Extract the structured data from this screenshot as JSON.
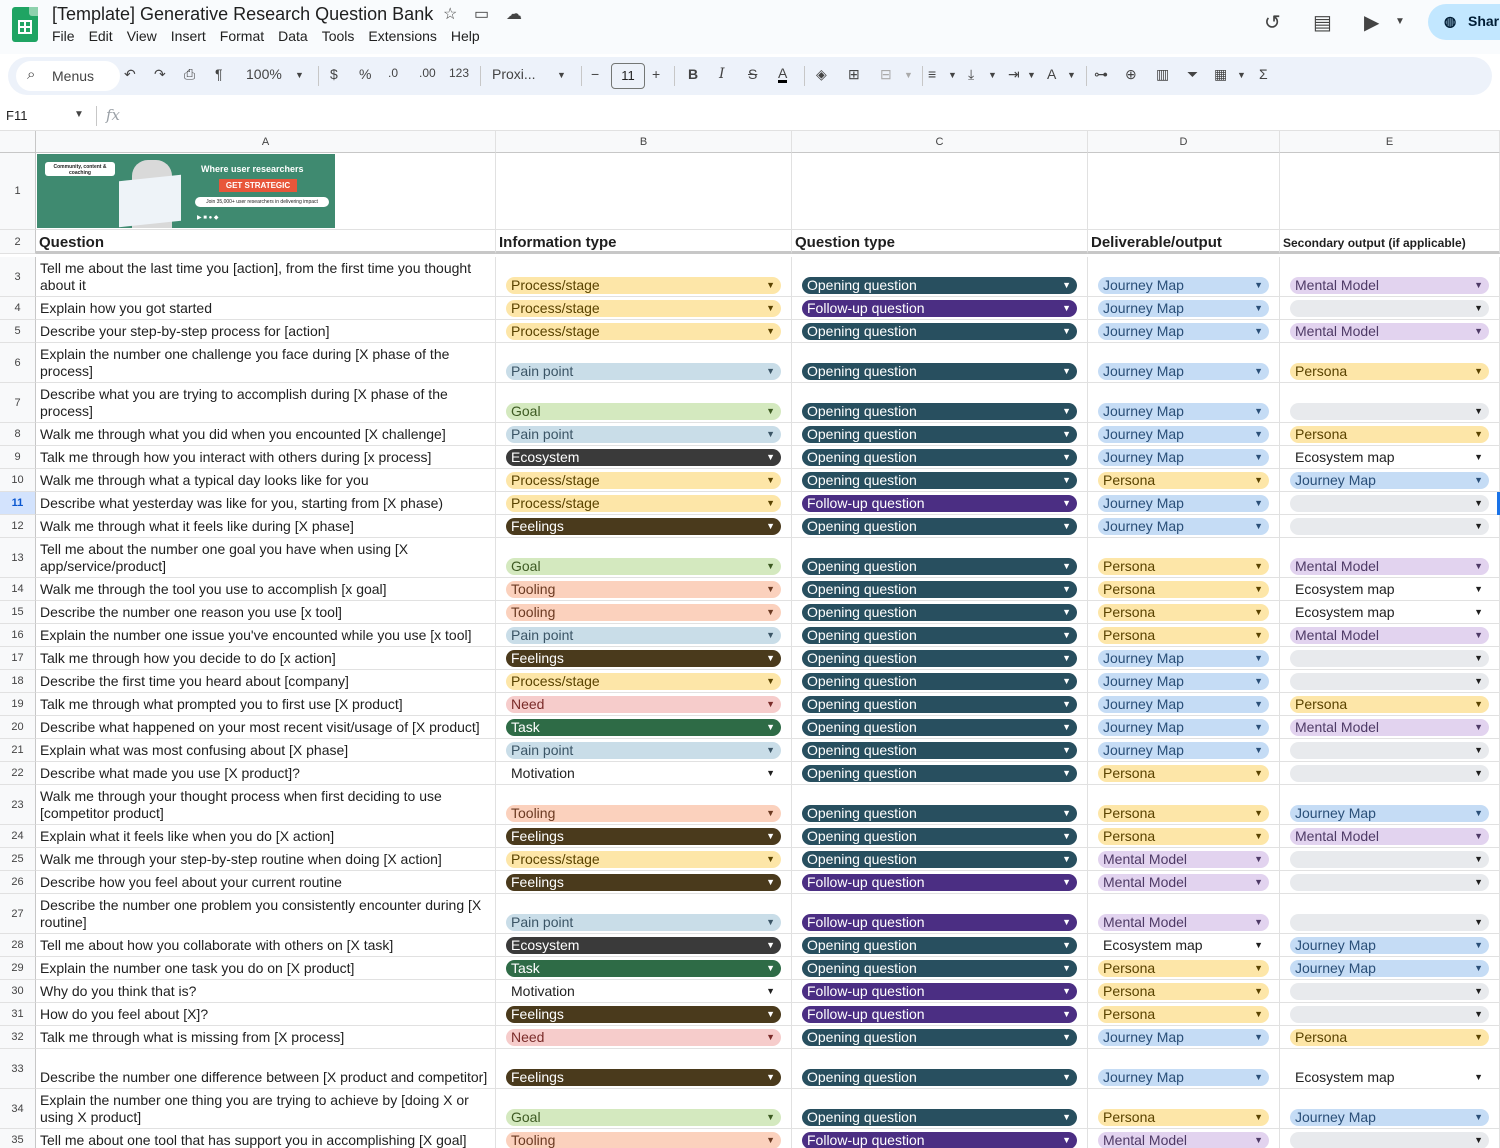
{
  "app": {
    "doc_title": "[Template] Generative Research Question Bank",
    "menu": [
      "File",
      "Edit",
      "View",
      "Insert",
      "Format",
      "Data",
      "Tools",
      "Extensions",
      "Help"
    ],
    "share_label": "Shar"
  },
  "toolbar": {
    "menus_label": "Menus",
    "zoom": "100%",
    "currency": "$",
    "percent": "%",
    "dec_decrease": ".0",
    "dec_increase": ".00",
    "number_format": "123",
    "font": "Proxi...",
    "font_size": "11"
  },
  "formula_bar": {
    "cell_ref": "F11",
    "fx_label": "fx"
  },
  "columns": [
    "A",
    "B",
    "C",
    "D",
    "E"
  ],
  "banner": {
    "badge": "Community, content & coaching",
    "headline": "Where user researchers",
    "cta": "GET STRATEGIC",
    "join": "Join 35,000+ user researchers in delivering impact"
  },
  "headers": {
    "question": "Question",
    "info_type": "Information type",
    "question_type": "Question type",
    "deliverable": "Deliverable/output",
    "secondary": "Secondary output (if applicable)"
  },
  "rows": [
    {
      "n": "3",
      "q": "Tell me about the last time you [action], from the first time you thought about it",
      "info": "Process/stage",
      "qtype": "Opening question",
      "del": "Journey Map",
      "sec": "Mental Model"
    },
    {
      "n": "4",
      "q": "Explain how you got started",
      "info": "Process/stage",
      "qtype": "Follow-up question",
      "del": "Journey Map",
      "sec": ""
    },
    {
      "n": "5",
      "q": "Describe your step-by-step process for [action]",
      "info": "Process/stage",
      "qtype": "Opening question",
      "del": "Journey Map",
      "sec": "Mental Model"
    },
    {
      "n": "6",
      "q": "Explain the number one challenge you face during [X phase of the process]",
      "info": "Pain point",
      "qtype": "Opening question",
      "del": "Journey Map",
      "sec": "Persona"
    },
    {
      "n": "7",
      "q": "Describe what you are trying to accomplish during [X phase of the process]",
      "info": "Goal",
      "qtype": "Opening question",
      "del": "Journey Map",
      "sec": ""
    },
    {
      "n": "8",
      "q": "Walk me through what you did when you encounted [X challenge]",
      "info": "Pain point",
      "qtype": "Opening question",
      "del": "Journey Map",
      "sec": "Persona"
    },
    {
      "n": "9",
      "q": "Talk me through how you interact with others during [x process]",
      "info": "Ecosystem",
      "qtype": "Opening question",
      "del": "Journey Map",
      "sec": "Ecosystem map"
    },
    {
      "n": "10",
      "q": "Walk me through what a typical day looks like for you",
      "info": "Process/stage",
      "qtype": "Opening question",
      "del": "Persona",
      "sec": "Journey Map"
    },
    {
      "n": "11",
      "q": "Describe what yesterday was like for you, starting from [X phase)",
      "info": "Process/stage",
      "qtype": "Follow-up question",
      "del": "Journey Map",
      "sec": ""
    },
    {
      "n": "12",
      "q": "Walk me through what it feels like during [X phase]",
      "info": "Feelings",
      "qtype": "Opening question",
      "del": "Journey Map",
      "sec": ""
    },
    {
      "n": "13",
      "q": "Tell me about the number one goal you have when using [X app/service/product]",
      "info": "Goal",
      "qtype": "Opening question",
      "del": "Persona",
      "sec": "Mental Model"
    },
    {
      "n": "14",
      "q": "Walk me through the tool you use to accomplish [x goal]",
      "info": "Tooling",
      "qtype": "Opening question",
      "del": "Persona",
      "sec": "Ecosystem map"
    },
    {
      "n": "15",
      "q": "Describe the number one reason you use [x tool]",
      "info": "Tooling",
      "qtype": "Opening question",
      "del": "Persona",
      "sec": "Ecosystem map"
    },
    {
      "n": "16",
      "q": "Explain the number one issue you've encounted while you use [x tool]",
      "info": "Pain point",
      "qtype": "Opening question",
      "del": "Persona",
      "sec": "Mental Model"
    },
    {
      "n": "17",
      "q": "Talk me through how you decide to do [x action]",
      "info": "Feelings",
      "qtype": "Opening question",
      "del": "Journey Map",
      "sec": ""
    },
    {
      "n": "18",
      "q": "Describe the first time you heard about [company]",
      "info": "Process/stage",
      "qtype": "Opening question",
      "del": "Journey Map",
      "sec": ""
    },
    {
      "n": "19",
      "q": "Talk me through what prompted you to first use [X product]",
      "info": "Need",
      "qtype": "Opening question",
      "del": "Journey Map",
      "sec": "Persona"
    },
    {
      "n": "20",
      "q": "Describe what happened on your most recent visit/usage of [X product]",
      "info": "Task",
      "qtype": "Opening question",
      "del": "Journey Map",
      "sec": "Mental Model"
    },
    {
      "n": "21",
      "q": "Explain what was most confusing about [X phase]",
      "info": "Pain point",
      "qtype": "Opening question",
      "del": "Journey Map",
      "sec": ""
    },
    {
      "n": "22",
      "q": "Describe what made you use [X product]?",
      "info": "Motivation",
      "qtype": "Opening question",
      "del": "Persona",
      "sec": ""
    },
    {
      "n": "23",
      "q": "Walk me through your thought process when first deciding to use [competitor product]",
      "info": "Tooling",
      "qtype": "Opening question",
      "del": "Persona",
      "sec": "Journey Map"
    },
    {
      "n": "24",
      "q": "Explain what it feels like when you do [X action]",
      "info": "Feelings",
      "qtype": "Opening question",
      "del": "Persona",
      "sec": "Mental Model"
    },
    {
      "n": "25",
      "q": "Walk me through your step-by-step routine when doing [X action]",
      "info": "Process/stage",
      "qtype": "Opening question",
      "del": "Mental Model",
      "sec": ""
    },
    {
      "n": "26",
      "q": "Describe how you feel about your current routine",
      "info": "Feelings",
      "qtype": "Follow-up question",
      "del": "Mental Model",
      "sec": ""
    },
    {
      "n": "27",
      "q": "Describe the number one problem you consistently encounter during [X routine]",
      "info": "Pain point",
      "qtype": "Follow-up question",
      "del": "Mental Model",
      "sec": ""
    },
    {
      "n": "28",
      "q": "Tell me about how you collaborate with others on [X task]",
      "info": "Ecosystem",
      "qtype": "Opening question",
      "del": "Ecosystem map",
      "sec": "Journey Map"
    },
    {
      "n": "29",
      "q": "Explain the number one task you do on [X product]",
      "info": "Task",
      "qtype": "Opening question",
      "del": "Persona",
      "sec": "Journey Map"
    },
    {
      "n": "30",
      "q": "Why do you think that is?",
      "info": "Motivation",
      "qtype": "Follow-up question",
      "del": "Persona",
      "sec": ""
    },
    {
      "n": "31",
      "q": "How do you feel about [X]?",
      "info": "Feelings",
      "qtype": "Follow-up question",
      "del": "Persona",
      "sec": ""
    },
    {
      "n": "32",
      "q": "Talk me through what is missing from [X process]",
      "info": "Need",
      "qtype": "Opening question",
      "del": "Journey Map",
      "sec": "Persona"
    },
    {
      "n": "33",
      "q": "Describe the number one difference between [X product and competitor]",
      "info": "Feelings",
      "qtype": "Opening question",
      "del": "Journey Map",
      "sec": "Ecosystem map"
    },
    {
      "n": "34",
      "q": "Explain the number one thing you are trying to achieve by [doing X or using X product]",
      "info": "Goal",
      "qtype": "Opening question",
      "del": "Persona",
      "sec": "Journey Map"
    },
    {
      "n": "35",
      "q": "Tell me about one tool that has support you in accomplishing [X goal]",
      "info": "Tooling",
      "qtype": "Follow-up question",
      "del": "Mental Model",
      "sec": ""
    }
  ],
  "chip_colors": {
    "Process/stage": {
      "bg": "#fde6a8",
      "fg": "#5a4300"
    },
    "Pain point": {
      "bg": "#c9dde8",
      "fg": "#3b5566"
    },
    "Goal": {
      "bg": "#d4e9bf",
      "fg": "#3d5a22"
    },
    "Ecosystem": {
      "bg": "#3a3a3a",
      "fg": "#ffffff"
    },
    "Feelings": {
      "bg": "#4a3a1c",
      "fg": "#ffffff"
    },
    "Tooling": {
      "bg": "#fbd1bd",
      "fg": "#6b3a22"
    },
    "Need": {
      "bg": "#f6cccb",
      "fg": "#7a2b29"
    },
    "Task": {
      "bg": "#2e6b46",
      "fg": "#ffffff"
    },
    "Motivation": {
      "bg": "#ffffff",
      "fg": "#1f1f1f"
    },
    "Opening question": {
      "bg": "#284f5f",
      "fg": "#ffffff"
    },
    "Follow-up question": {
      "bg": "#4b2e83",
      "fg": "#ffffff"
    },
    "Journey Map": {
      "bg": "#c5dcf5",
      "fg": "#2a4f78"
    },
    "Mental Model": {
      "bg": "#e2d3ef",
      "fg": "#4e3a66"
    },
    "Persona": {
      "bg": "#fde6a8",
      "fg": "#5a4300"
    },
    "Ecosystem map": {
      "bg": "#ffffff",
      "fg": "#1f1f1f"
    },
    "": {
      "bg": "#e8eaed",
      "fg": "#1f1f1f"
    }
  }
}
